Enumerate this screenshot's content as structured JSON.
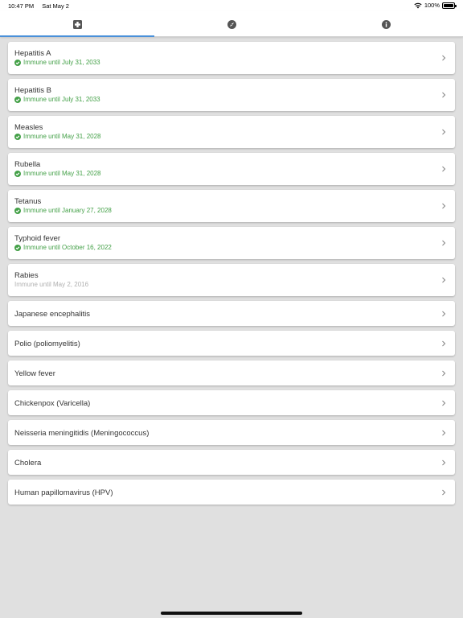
{
  "status_bar": {
    "time": "10:47 PM",
    "date": "Sat May 2",
    "battery": "100%",
    "icons": [
      "wifi-icon",
      "battery-icon"
    ]
  },
  "tabs": [
    {
      "icon": "medical-plus-icon",
      "selected": true
    },
    {
      "icon": "compass-icon",
      "selected": false
    },
    {
      "icon": "info-icon",
      "selected": false
    }
  ],
  "colors": {
    "accent": "#4a90d9",
    "valid": "#43a047",
    "expired": "#b0b0b0",
    "background": "#e0e0e0"
  },
  "vaccines": [
    {
      "name": "Hepatitis A",
      "status": "Immune until July 31, 2033",
      "state": "valid"
    },
    {
      "name": "Hepatitis B",
      "status": "Immune until July 31, 2033",
      "state": "valid"
    },
    {
      "name": "Measles",
      "status": "Immune until May 31, 2028",
      "state": "valid"
    },
    {
      "name": "Rubella",
      "status": "Immune until May 31, 2028",
      "state": "valid"
    },
    {
      "name": "Tetanus",
      "status": "Immune until January 27, 2028",
      "state": "valid"
    },
    {
      "name": "Typhoid fever",
      "status": "Immune until October 16, 2022",
      "state": "valid"
    },
    {
      "name": "Rabies",
      "status": "Immune until May 2, 2016",
      "state": "expired"
    },
    {
      "name": "Japanese encephalitis"
    },
    {
      "name": "Polio (poliomyelitis)"
    },
    {
      "name": "Yellow fever"
    },
    {
      "name": "Chickenpox (Varicella)"
    },
    {
      "name": "Neisseria meningitidis (Meningococcus)"
    },
    {
      "name": "Cholera"
    },
    {
      "name": "Human papillomavirus (HPV)"
    }
  ]
}
